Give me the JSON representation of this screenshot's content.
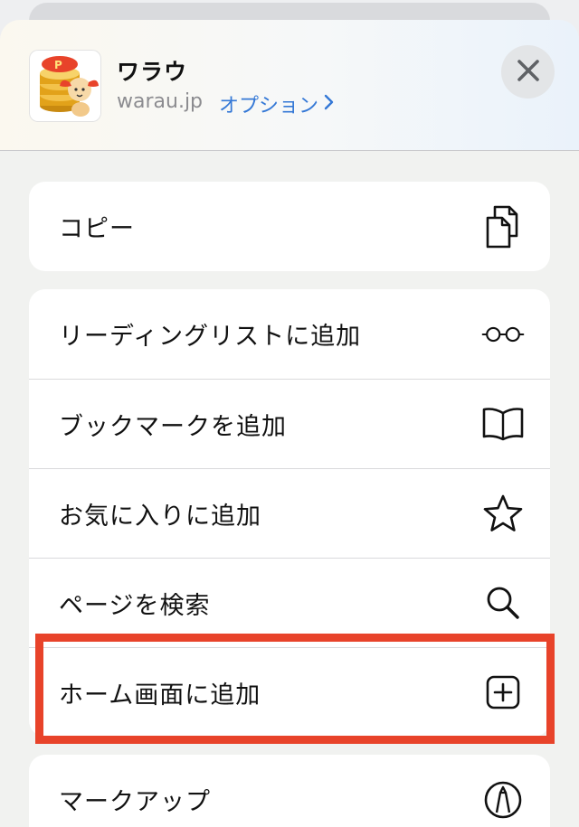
{
  "header": {
    "app_name": "ワラウ",
    "url": "warau.jp",
    "options_label": "オプション",
    "options_chevron": "chevron-right-icon",
    "close_icon": "close-icon"
  },
  "actions": {
    "copy": {
      "label": "コピー",
      "icon": "copy-icon"
    },
    "reading_list": {
      "label": "リーディングリストに追加",
      "icon": "glasses-icon"
    },
    "bookmark": {
      "label": "ブックマークを追加",
      "icon": "book-icon"
    },
    "favorites": {
      "label": "お気に入りに追加",
      "icon": "star-icon"
    },
    "find_on_page": {
      "label": "ページを検索",
      "icon": "magnifier-icon"
    },
    "add_to_home": {
      "label": "ホーム画面に追加",
      "icon": "plus-square-icon"
    },
    "markup": {
      "label": "マークアップ",
      "icon": "markup-pen-icon"
    }
  },
  "colors": {
    "link": "#3478d6",
    "highlight_border": "#e8432a",
    "icon_gold": "#e2a21a",
    "icon_red": "#e8432a"
  }
}
